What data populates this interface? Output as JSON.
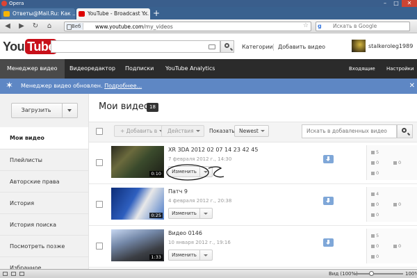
{
  "browser": {
    "window_title": "Opera",
    "tabs": [
      {
        "label": "Ответы@Mail.Ru: Как ..."
      },
      {
        "label": "YouTube - Broadcast Y..."
      }
    ],
    "address": {
      "site_chip": "Веб",
      "url_host": "www.youtube.com",
      "url_path": "/my_videos"
    },
    "search": {
      "placeholder": "Искать в Google"
    }
  },
  "masthead": {
    "logo_you": "You",
    "logo_tube": "Tube",
    "categories": "Категории",
    "add_video": "Добавить видео",
    "username": "stalkeroleg1989"
  },
  "nav": {
    "items": [
      "Менеджер видео",
      "Видеоредактор",
      "Подписки",
      "YouTube Analytics"
    ],
    "right": [
      "Входящие",
      "Настройки"
    ]
  },
  "notice": {
    "message": "Менеджер видео обновлен.",
    "link": "Подробнее..."
  },
  "sidebar": {
    "upload_label": "Загрузить",
    "items": [
      "Мои видео",
      "Плейлисты",
      "Авторские права",
      "История",
      "История поиска",
      "Посмотреть позже",
      "Избранное"
    ]
  },
  "main": {
    "title": "Мои видео",
    "count": "18",
    "toolbar": {
      "add_to": "+ Добавить в",
      "actions": "Действия",
      "show_label": "Показать:",
      "sort": "Newest",
      "search_placeholder": "Искать в добавленных видео"
    },
    "videos": [
      {
        "title": "XR 3DA 2012 02 07 14 23 42 45",
        "date": "7 февраля 2012 г., 14:30",
        "duration": "0:10",
        "edit": "Изменить",
        "views": "5",
        "likes": "0",
        "dislikes": "0",
        "comments": "0"
      },
      {
        "title": "Патч 9",
        "date": "4 февраля 2012 г., 20:38",
        "duration": "0:25",
        "edit": "Изменить",
        "views": "4",
        "likes": "0",
        "dislikes": "0",
        "comments": "0"
      },
      {
        "title": "Видео 0146",
        "date": "10 января 2012 г., 19:16",
        "duration": "1:33",
        "edit": "Изменить",
        "views": "5",
        "likes": "0",
        "dislikes": "0",
        "comments": "0"
      }
    ]
  },
  "statusbar": {
    "view_label": "Вид (100%)",
    "zoom": "100%"
  },
  "colors": {
    "yt_red": "#c8101a",
    "nav_dark": "#2b2b2b",
    "notice_blue": "#5e87c4",
    "opera_blue": "#39618f"
  }
}
